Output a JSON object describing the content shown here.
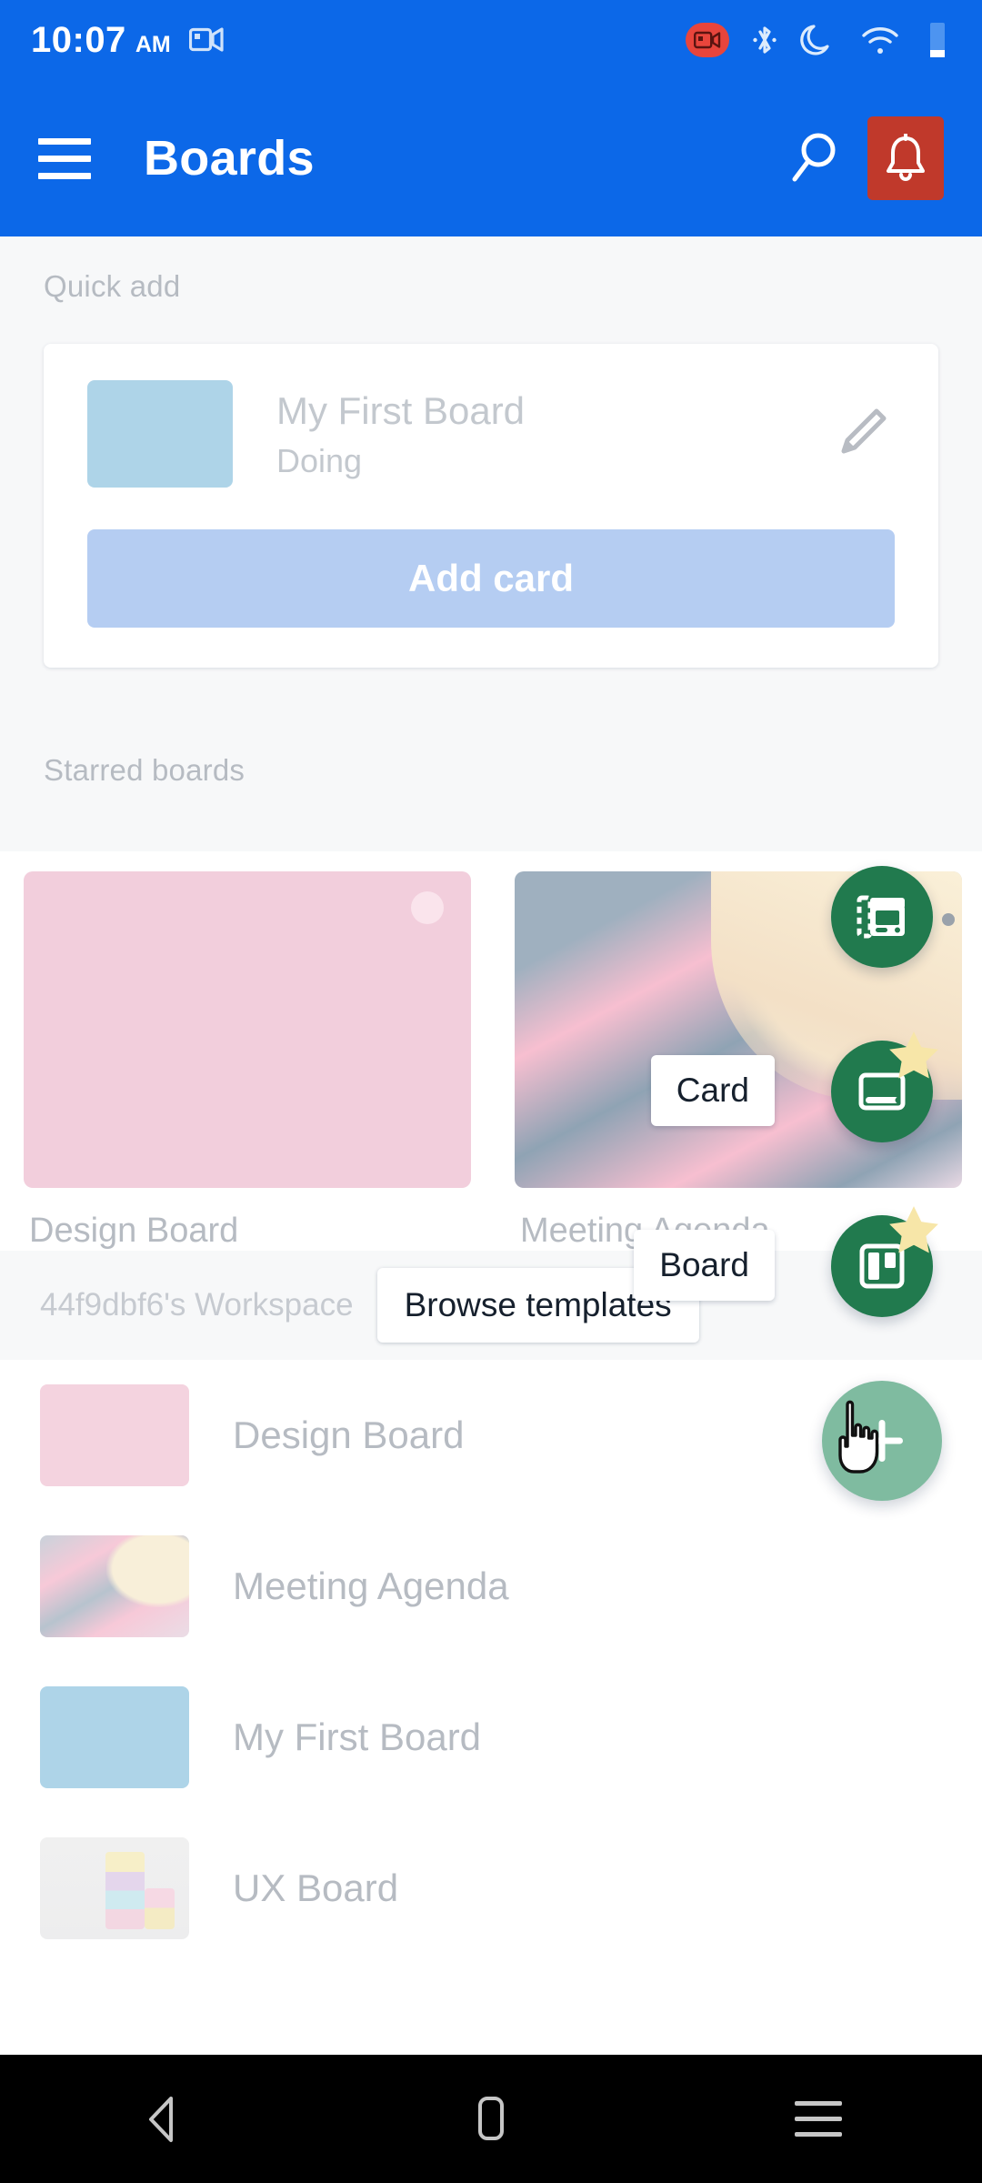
{
  "status_bar": {
    "time": "10:07",
    "ampm": "AM",
    "icons": [
      "screen-cast-icon",
      "screen-record-icon",
      "bluetooth-icon",
      "do-not-disturb-icon",
      "wifi-icon",
      "battery-icon"
    ]
  },
  "app_bar": {
    "title": "Boards",
    "menu_icon": "hamburger-menu-icon",
    "search_icon": "search-icon",
    "notification_icon": "bell-icon",
    "background_color": "#0C68E8",
    "notification_highlight_color": "#C0392B"
  },
  "quick_add": {
    "section_label": "Quick add",
    "board_name": "My First Board",
    "list_name": "Doing",
    "edit_icon": "pencil-edit-icon",
    "thumbnail_color": "#AED4E8",
    "add_card_label": "Add card",
    "add_card_color": "#B5CDF2"
  },
  "starred": {
    "section_label": "Starred boards",
    "boards": [
      {
        "name": "Design Board",
        "thumb": "solid-pink",
        "color": "#F2CEDC"
      },
      {
        "name": "Meeting Agenda",
        "thumb": "photo-cafe",
        "color": "#F7BFD0"
      }
    ]
  },
  "workspace": {
    "name": "44f9dbf6's Workspace",
    "browse_templates_label": "Browse templates"
  },
  "board_list": [
    {
      "name": "Design Board",
      "thumb": "solid-pink"
    },
    {
      "name": "Meeting Agenda",
      "thumb": "photo-cafe"
    },
    {
      "name": "My First Board",
      "thumb": "solid-blue"
    },
    {
      "name": "UX Board",
      "thumb": "photo-macarons"
    }
  ],
  "fab": {
    "main_icon": "plus-icon",
    "main_color": "#7FBBA0",
    "green_color": "#217A4E",
    "star_color": "#F7E6A8",
    "actions": [
      {
        "label": "",
        "icon": "templates-icon",
        "starred": false
      },
      {
        "label": "Card",
        "icon": "card-icon",
        "starred": true
      },
      {
        "label": "Board",
        "icon": "trello-board-icon",
        "starred": true
      }
    ],
    "cursor": "hand-pointer-cursor"
  },
  "nav_bar": {
    "back": "back-triangle-icon",
    "home": "home-pill-icon",
    "recents": "recents-lines-icon"
  }
}
